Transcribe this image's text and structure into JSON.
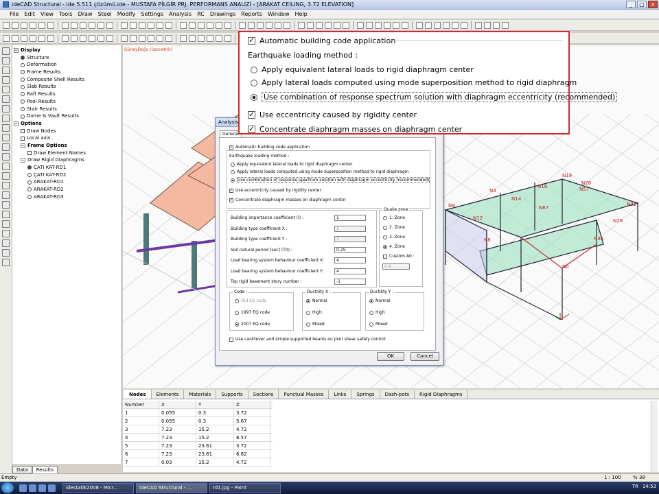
{
  "window": {
    "title": "ideCAD Structural - ide 5.511 çözümü.ide - MUSTAFA PİLGİR PRJ. PERFORMANS ANALİZİ - [ARAKAT CEILING, 3.72 ELEVATION]"
  },
  "menu": [
    "File",
    "Edit",
    "View",
    "Tools",
    "Draw",
    "Steel",
    "Modify",
    "Settings",
    "Analysis",
    "RC",
    "Drawings",
    "Reports",
    "Window",
    "Help"
  ],
  "tree": {
    "items": [
      {
        "label": "Display",
        "level": 0,
        "type": "box",
        "bold": true
      },
      {
        "label": "Structure",
        "level": 1,
        "type": "dot-on"
      },
      {
        "label": "Deformation",
        "level": 1,
        "type": "dot"
      },
      {
        "label": "Frame Results",
        "level": 1,
        "type": "dot"
      },
      {
        "label": "Composite Shell Results",
        "level": 1,
        "type": "dot"
      },
      {
        "label": "Slab Results",
        "level": 1,
        "type": "dot"
      },
      {
        "label": "Raft Results",
        "level": 1,
        "type": "dot"
      },
      {
        "label": "Pool Results",
        "level": 1,
        "type": "dot"
      },
      {
        "label": "Stair Results",
        "level": 1,
        "type": "dot"
      },
      {
        "label": "Dome & Vault Results",
        "level": 1,
        "type": "dot"
      },
      {
        "label": "Options",
        "level": 0,
        "type": "box",
        "bold": true
      },
      {
        "label": "Draw Nodes",
        "level": 1,
        "type": "sq"
      },
      {
        "label": "Local axis",
        "level": 1,
        "type": "sq"
      },
      {
        "label": "Frame Options",
        "level": 1,
        "type": "box",
        "bold": true
      },
      {
        "label": "Draw Element Names",
        "level": 2,
        "type": "sq"
      },
      {
        "label": "Draw Rigid Diaphragms",
        "level": 1,
        "type": "box"
      },
      {
        "label": "ÇATI KAT-RD1",
        "level": 2,
        "type": "dot-on"
      },
      {
        "label": "ÇATI KAT-RD2",
        "level": 2,
        "type": "dot"
      },
      {
        "label": "ARAKAT-RD1",
        "level": 2,
        "type": "dot"
      },
      {
        "label": "ARAKAT-RD2",
        "level": 2,
        "type": "dot"
      },
      {
        "label": "ARAKAT-RD3",
        "level": 2,
        "type": "dot"
      }
    ],
    "tabs": [
      "Data",
      "Results"
    ],
    "active_tab": "Results"
  },
  "view": {
    "label": "GüneyDoğu (izometrik)",
    "node_labels": [
      "N18",
      "N26",
      "N57",
      "N4",
      "N16",
      "N14",
      "N9",
      "N67",
      "N12",
      "N28",
      "N32",
      "N8",
      "N38",
      "N0"
    ]
  },
  "dialog": {
    "title": "Analysis ...",
    "tab": "General",
    "auto_code": "Automatic building code application",
    "eq_method_label": "Earthquake loading method :",
    "methods": [
      "Apply equivalent lateral loads to rigid diaphragm center",
      "Apply lateral loads computed using mode superposition method to rigid diaphragm",
      "Use combination of response spectrum solution with diaphragm eccentricity (recommended)"
    ],
    "use_ecc": "Use eccentricity caused by rigidity center",
    "concentrate": "Concentrate diaphragm masses on diaphragm center",
    "params": [
      {
        "label": "Building importance coefficient (I) :",
        "value": "1",
        "disabled": false
      },
      {
        "label": "Building type coefficient X :",
        "value": "1",
        "disabled": true
      },
      {
        "label": "Building type coefficient Y :",
        "value": "1",
        "disabled": true
      },
      {
        "label": "Soil natural period [sec] (T0) :",
        "value": "0.25",
        "disabled": false
      },
      {
        "label": "Load bearing system behaviour coefficient X:",
        "value": "4",
        "disabled": false
      },
      {
        "label": "Load bearing system behaviour coefficient Y:",
        "value": "4",
        "disabled": false
      },
      {
        "label": "Top rigid basement story number :",
        "value": "-1",
        "disabled": false
      }
    ],
    "quake_zone_title": "Quake zone",
    "zones": [
      "1. Zone",
      "2. Zone",
      "3. Zone",
      "4. Zone"
    ],
    "zone_selected": 3,
    "custom_a0": "Custom A0 :",
    "a0_value": "0.4",
    "code_title": "Code :",
    "codes": [
      "Old EQ code",
      "1997 EQ code",
      "2007 EQ code"
    ],
    "code_selected": 2,
    "ductx_title": "Ductility X :",
    "ducty_title": "Ductility Y :",
    "ductility": [
      "Normal",
      "High",
      "Mixed"
    ],
    "cantilever": "Use cantilever and simple supported beams on joint shear safety control",
    "ok": "OK",
    "cancel": "Cancel"
  },
  "zoom": {
    "auto_code": "Automatic building code application",
    "eq_method_label": "Earthquake loading method :",
    "methods": [
      "Apply equivalent lateral loads to rigid diaphragm center",
      "Apply lateral loads computed using mode superposition method to rigid diaphragm",
      "Use combination of response spectrum solution with diaphragm eccentricity (recommended)"
    ],
    "use_ecc": "Use eccentricity caused by rigidity center",
    "concentrate": "Concentrate diaphragm masses on diaphragm center"
  },
  "bottom_tabs": [
    "Nodes",
    "Elements",
    "Materials",
    "Supports",
    "Sections",
    "Punctual Masses",
    "Links",
    "Springs",
    "Dash-pots",
    "Rigid Diaphragms"
  ],
  "grid": {
    "headers": [
      "Number",
      "X",
      "Y",
      "Z"
    ],
    "rows": [
      [
        "1",
        "0.055",
        "0.3",
        "3.72"
      ],
      [
        "2",
        "0.055",
        "0.3",
        "5.67"
      ],
      [
        "3",
        "7.23",
        "15.2",
        "4.72"
      ],
      [
        "4",
        "7.23",
        "15.2",
        "8.57"
      ],
      [
        "5",
        "7.23",
        "23.61",
        "3.72"
      ],
      [
        "6",
        "7.23",
        "23.61",
        "6.82"
      ],
      [
        "7",
        "0.03",
        "15.2",
        "4.72"
      ]
    ]
  },
  "status": {
    "left": "Empty",
    "scale": "1 : 100",
    "zoom": "% 38"
  },
  "taskbar": {
    "tasks": [
      "idestatik2008 - Micr...",
      "ideCAD Structural - ...",
      "rd1.jpg - Paint"
    ],
    "active": 1,
    "lang": "TR",
    "time": "14:53"
  }
}
